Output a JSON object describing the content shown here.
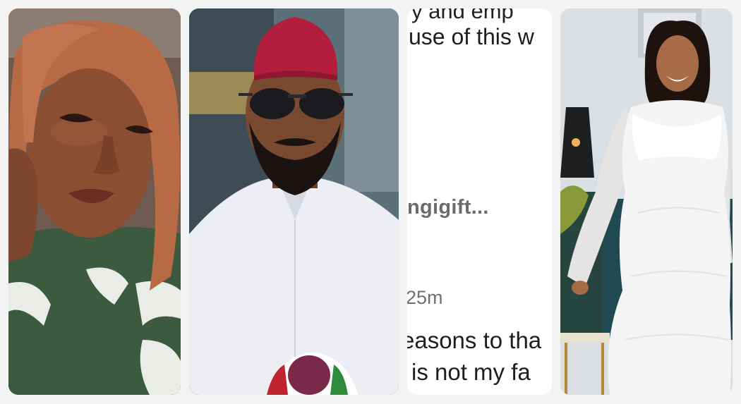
{
  "collage": {
    "panels": [
      {
        "subject": "woman-selfie",
        "outfit_color": "#3b5a3e",
        "hair_color": "#b86a45"
      },
      {
        "subject": "man-red-cap-sunglasses",
        "cap_color": "#b21e3c",
        "outfit_color": "#eceef4"
      },
      {
        "subject": "social-comment-crop",
        "background_color": "#ffffff"
      },
      {
        "subject": "woman-white-gown",
        "gown_color": "#f4f4f4",
        "background_color": "#d9dfe2"
      }
    ]
  },
  "comment": {
    "line_top": "y and emp",
    "line_2": "use of this w",
    "username": "ngigift...",
    "time": "25m",
    "line_5": "easons to tha",
    "line_6": "is not my fa"
  }
}
